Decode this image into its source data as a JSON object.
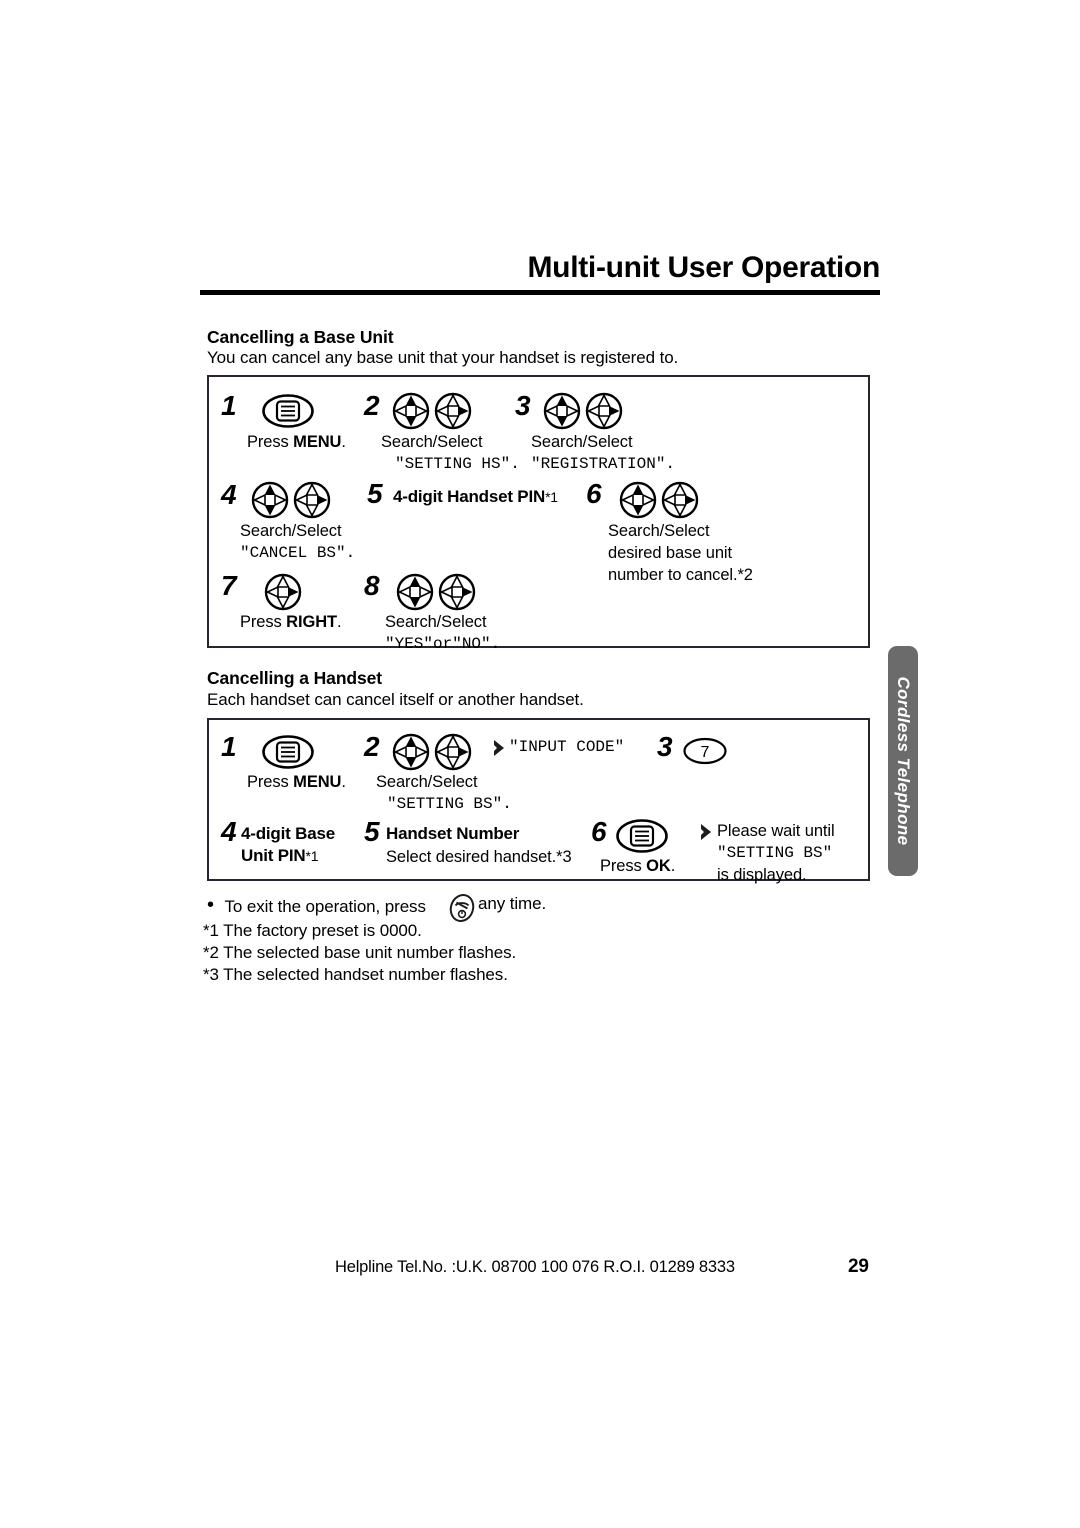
{
  "header": {
    "title": "Multi-unit User Operation"
  },
  "sections": [
    {
      "heading": "Cancelling a Base Unit",
      "intro": "You can cancel any base unit that your handset is registered to."
    },
    {
      "heading": "Cancelling a Handset",
      "intro": "Each handset can cancel itself or another handset."
    }
  ],
  "box_base_unit": {
    "steps": [
      {
        "num": "1",
        "icon": "menu-key-icon",
        "label": "Press ",
        "label_bold": "MENU",
        "label_tail": ".",
        "display": ""
      },
      {
        "num": "2",
        "icon": "nav-updown-then-right-icon",
        "label": "Search/Select",
        "display": "\"SETTING HS\"."
      },
      {
        "num": "3",
        "icon": "nav-updown-then-right-icon",
        "label": "Search/Select",
        "display": "\"REGISTRATION\"."
      },
      {
        "num": "4",
        "icon": "nav-updown-then-right-icon",
        "label": "Search/Select",
        "display": "\"CANCEL BS\"."
      },
      {
        "num": "5",
        "bold_label": "4-digit Handset PIN",
        "bold_sup": "*1"
      },
      {
        "num": "6",
        "icon": "nav-updown-then-right-icon",
        "label": "Search/Select",
        "line2": "desired base unit",
        "line3": "number to cancel.*2"
      },
      {
        "num": "7",
        "icon": "nav-right-icon",
        "label": "Press ",
        "label_bold": "RIGHT",
        "label_tail": "."
      },
      {
        "num": "8",
        "icon": "nav-updown-then-right-icon",
        "label": "Search/Select",
        "display": "\"YES\"or\"NO\"."
      }
    ]
  },
  "box_handset": {
    "steps": [
      {
        "num": "1",
        "icon": "menu-key-icon",
        "label": "Press ",
        "label_bold": "MENU",
        "label_tail": "."
      },
      {
        "num": "2",
        "icon": "nav-updown-then-right-icon",
        "label": "Search/Select",
        "display": "\"SETTING BS\"."
      },
      {
        "num": "3",
        "icon": "key-7-icon"
      },
      {
        "num": "4",
        "bold_label": "4-digit Base",
        "bold_label2": "Unit PIN",
        "bold_sup": "*1"
      },
      {
        "num": "5",
        "bold_label": "Handset Number",
        "sub_label": "Select desired handset.*3"
      },
      {
        "num": "6",
        "icon": "menu-key-icon",
        "label": "Press ",
        "label_bold": "OK",
        "label_tail": "."
      }
    ],
    "callout_input_code": "\"INPUT CODE\"",
    "callout_wait_line1": "Please wait until",
    "callout_wait_line2": "\"SETTING BS\"",
    "callout_wait_line3": "is displayed."
  },
  "footnotes": {
    "bullet_prefix": "To exit the operation, press",
    "bullet_icon": "power-off-key-icon",
    "bullet_suffix": "any time.",
    "items": [
      "*1 The factory preset is 0000.",
      "*2 The selected base unit number flashes.",
      "*3 The selected handset number flashes."
    ]
  },
  "side_tab": {
    "label": "Cordless Telephone",
    "color": "#6b6b6b"
  },
  "footer": {
    "helpline": "Helpline Tel.No. :U.K. 08700 100 076  R.O.I. 01289 8333",
    "page_number": "29"
  }
}
